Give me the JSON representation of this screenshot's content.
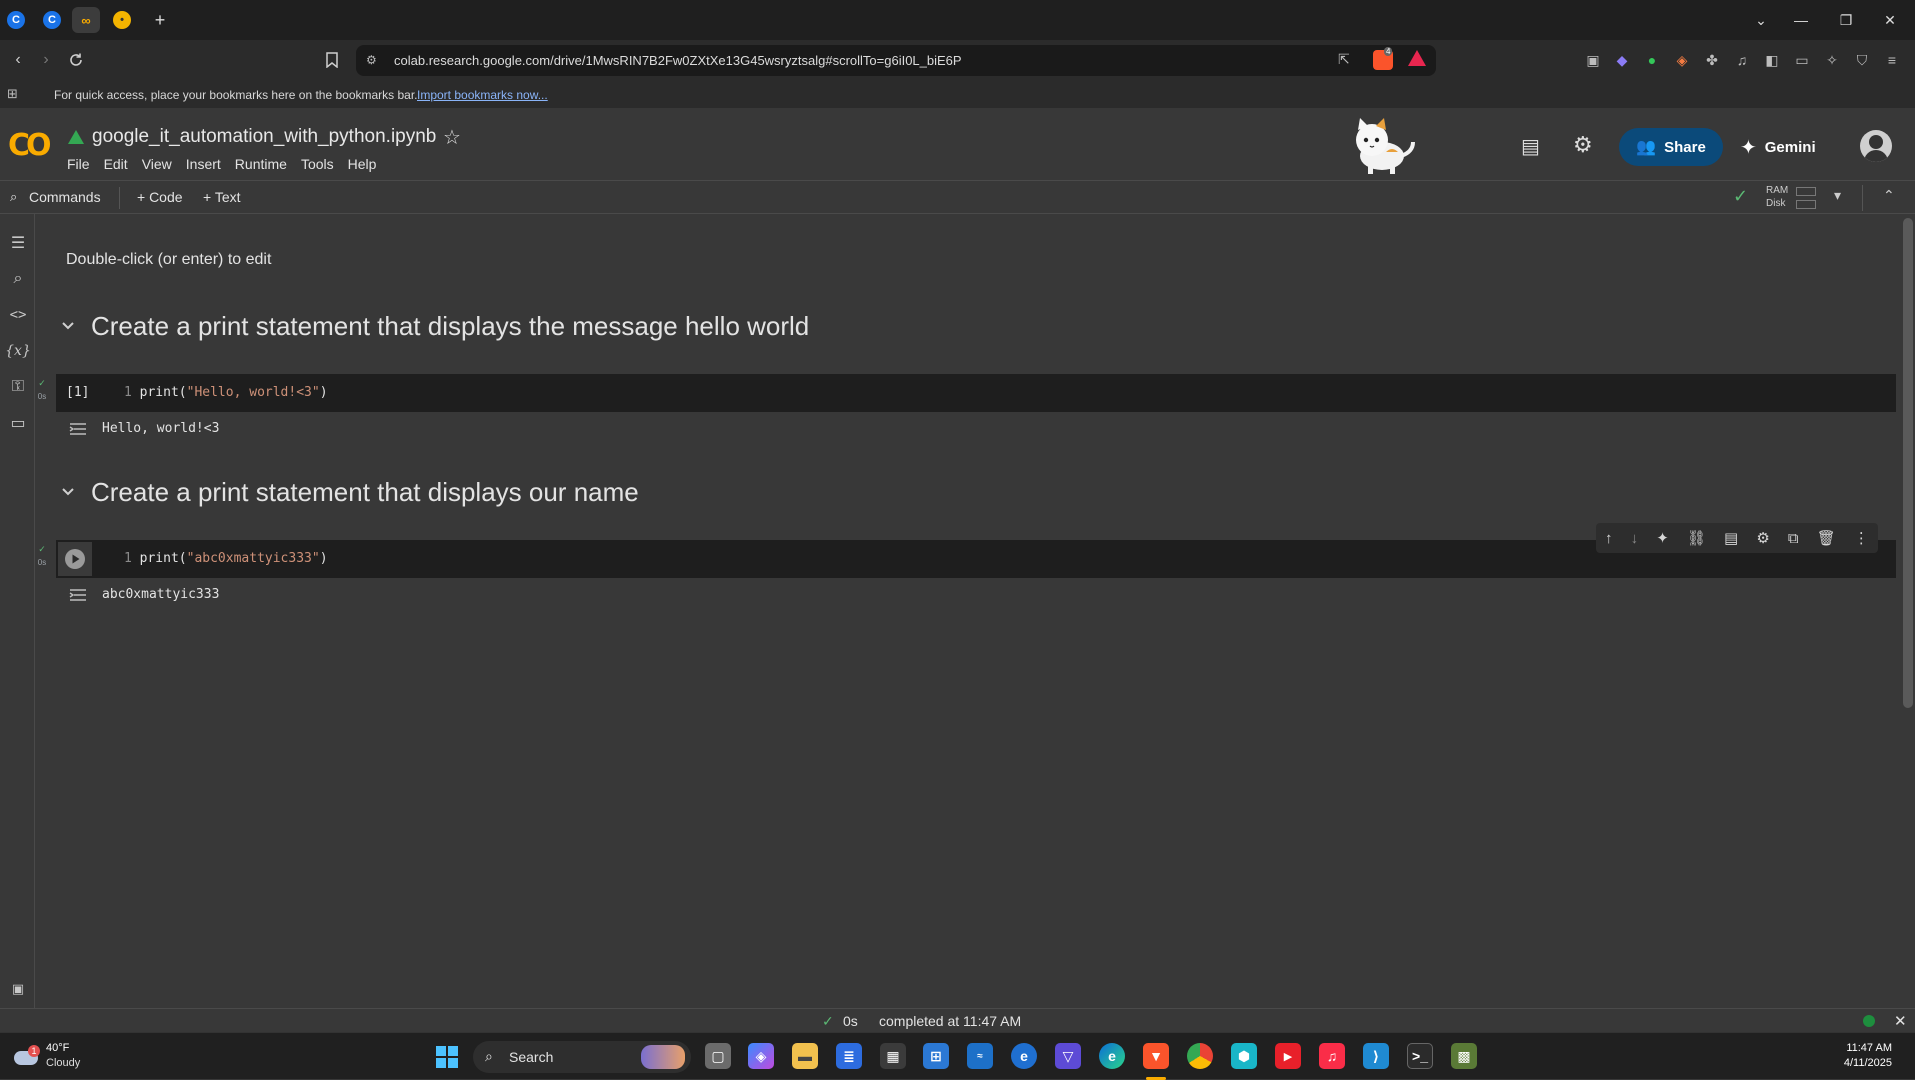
{
  "browser": {
    "url": "colab.research.google.com/drive/1MwsRIN7B2Fw0ZXtXe13G45wsryztsalg#scrollTo=g6iI0L_biE6P",
    "bookmarks_hint": "For quick access, place your bookmarks here on the bookmarks bar.",
    "bookmarks_link": "Import bookmarks now...",
    "brave_badge": "4"
  },
  "colab": {
    "logo": "CO",
    "notebook_title": "google_it_automation_with_python.ipynb",
    "menu": [
      "File",
      "Edit",
      "View",
      "Insert",
      "Runtime",
      "Tools",
      "Help"
    ],
    "share_label": "Share",
    "gemini_label": "Gemini"
  },
  "toolbar": {
    "commands": "Commands",
    "add_code": "+ Code",
    "add_text": "+ Text",
    "ram_label": "RAM",
    "disk_label": "Disk"
  },
  "notebook": {
    "edit_hint": "Double-click (or enter) to edit",
    "sections": [
      {
        "heading": "Create a print statement that displays the message hello world",
        "cell_number": "[1]",
        "line_number": "1",
        "code_fn": "print(",
        "code_str": "\"Hello, world!<3\"",
        "code_close": ")",
        "run_time": "0s",
        "output": "Hello, world!<3"
      },
      {
        "heading": "Create a print statement that displays our name",
        "line_number": "1",
        "code_fn": "print(",
        "code_str": "\"abc0xmattyic333\"",
        "code_close": ")",
        "run_time": "0s",
        "output": "abc0xmattyic333"
      }
    ]
  },
  "status": {
    "elapsed": "0s",
    "message": "completed at 11:47 AM"
  },
  "taskbar": {
    "temperature": "40°F",
    "weather": "Cloudy",
    "weather_badge": "1",
    "search_label": "Search",
    "time": "11:47 AM",
    "date": "4/11/2025"
  },
  "colors": {
    "accent": "#f9ab00",
    "share_bg": "#0b4a7a",
    "success": "#5bb974"
  }
}
